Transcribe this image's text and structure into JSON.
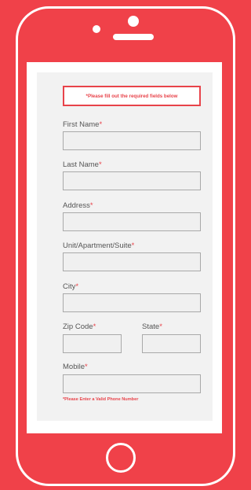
{
  "form": {
    "alert_mark": "*",
    "alert_text": "Please fill out the required fields below",
    "required_mark": "*",
    "fields": {
      "first_name": {
        "label": "First Name",
        "value": ""
      },
      "last_name": {
        "label": "Last Name",
        "value": ""
      },
      "address": {
        "label": "Address",
        "value": ""
      },
      "unit": {
        "label": "Unit/Apartment/Suite",
        "value": ""
      },
      "city": {
        "label": "City",
        "value": ""
      },
      "zip": {
        "label": "Zip Code",
        "value": ""
      },
      "state": {
        "label": "State",
        "value": ""
      },
      "mobile": {
        "label": "Mobile",
        "value": ""
      }
    },
    "mobile_error": "*Please Enter a Valid Phone Number"
  },
  "colors": {
    "background": "#f04149",
    "accent": "#e8434a",
    "form_bg": "#f2f2f2"
  },
  "icons": [
    "camera-icon",
    "speaker-icon",
    "home-button-icon"
  ]
}
